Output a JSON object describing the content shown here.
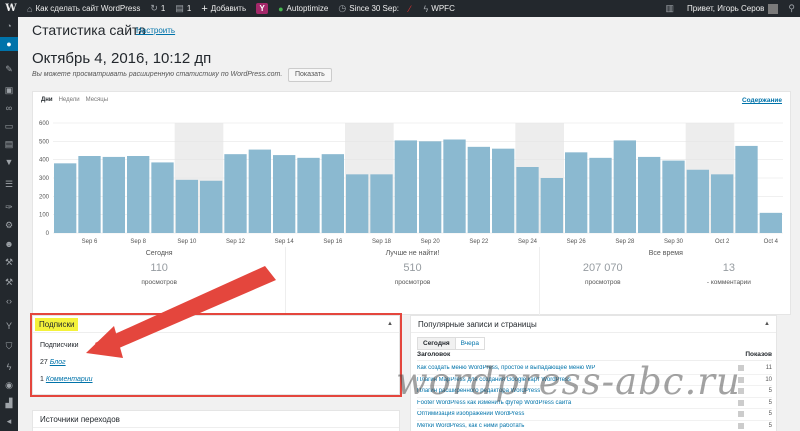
{
  "adminbar": {
    "site_name": "Как сделать сайт WordPress",
    "updates_count": "1",
    "comments_count": "1",
    "new_label": "Добавить",
    "autoptimize_label": "Autoptimize",
    "since_label": "Since 30 Sep:",
    "wpfc_label": "WPFC",
    "greeting": "Привет, Игорь Серов"
  },
  "header": {
    "title": "Статистика сайта",
    "configure_link": "Настроить",
    "date": "Октябрь 4, 2016, 10:12 дп",
    "notice": "Вы можете просматривать расширенную статистику по WordPress.com.",
    "show_button": "Показать"
  },
  "stats": {
    "period_tabs": [
      "Дни",
      "Недели",
      "Месяцы"
    ],
    "content_link": "Содержание",
    "summary": {
      "today_label": "Сегодня",
      "today_value": "110",
      "today_caption": "просмотров",
      "best_label": "Лучше не найти!",
      "best_value": "510",
      "best_caption": "просмотров",
      "all_label": "Все время",
      "all_views": "207 070",
      "all_views_caption": "просмотров",
      "all_comments": "13",
      "all_comments_caption": "- комментарии"
    }
  },
  "chart_data": {
    "type": "bar",
    "x": [
      "Sep 5",
      "Sep 6",
      "Sep 7",
      "Sep 8",
      "Sep 9",
      "Sep 10",
      "Sep 11",
      "Sep 12",
      "Sep 13",
      "Sep 14",
      "Sep 15",
      "Sep 16",
      "Sep 17",
      "Sep 18",
      "Sep 19",
      "Sep 20",
      "Sep 21",
      "Sep 22",
      "Sep 23",
      "Sep 24",
      "Sep 25",
      "Sep 26",
      "Sep 27",
      "Sep 28",
      "Sep 29",
      "Sep 30",
      "Oct 1",
      "Oct 2",
      "Oct 3",
      "Oct 4"
    ],
    "tick_labels": [
      "Sep 6",
      "Sep 8",
      "Sep 10",
      "Sep 12",
      "Sep 14",
      "Sep 16",
      "Sep 18",
      "Sep 20",
      "Sep 22",
      "Sep 24",
      "Sep 26",
      "Sep 28",
      "Sep 30",
      "Oct 2",
      "Oct 4"
    ],
    "values": [
      380,
      420,
      415,
      420,
      385,
      290,
      285,
      430,
      455,
      425,
      410,
      430,
      320,
      320,
      505,
      500,
      510,
      470,
      460,
      360,
      300,
      440,
      410,
      505,
      415,
      395,
      345,
      320,
      475,
      110
    ],
    "weekend_bands": [
      [
        "Sep 10",
        "Sep 11"
      ],
      [
        "Sep 17",
        "Sep 18"
      ],
      [
        "Sep 24",
        "Sep 25"
      ],
      [
        "Oct 1",
        "Oct 2"
      ]
    ],
    "ylim": [
      0,
      600
    ],
    "yticks": [
      0,
      100,
      200,
      300,
      400,
      500,
      600
    ],
    "grid": true,
    "bar_color": "#8bb9d0",
    "band_color": "#ededed"
  },
  "subscribers": {
    "title": "Подписки",
    "heading": "Подписчики",
    "blog_count": "27",
    "blog_link": "Блог",
    "comments_count": "1",
    "comments_link": "Комментарии"
  },
  "referrers": {
    "title": "Источники переходов"
  },
  "popular": {
    "title": "Популярные записи и страницы",
    "tabs": [
      "Сегодня",
      "Вчера"
    ],
    "col_title": "Заголовок",
    "col_views": "Показов",
    "rows": [
      {
        "title": "Как создать меню WordPress, простое и выпадающее меню WP",
        "views": "11"
      },
      {
        "title": "Плагин MapPress для создания Google карт WordPress",
        "views": "10"
      },
      {
        "title": "Плагин расширенного редактора WordPress",
        "views": "5"
      },
      {
        "title": "Footer WordPress как изменить футер WordPress сайта",
        "views": "5"
      },
      {
        "title": "Оптимизация изображений WordPress",
        "views": "5"
      },
      {
        "title": "Метки WordPress, как с ними работать",
        "views": "5"
      }
    ]
  },
  "watermark": "wordpress-abc.ru",
  "colors": {
    "accent": "#0073aa",
    "highlight": "#f4f23a",
    "outline": "#e4463d",
    "adminbar": "#23282d"
  }
}
